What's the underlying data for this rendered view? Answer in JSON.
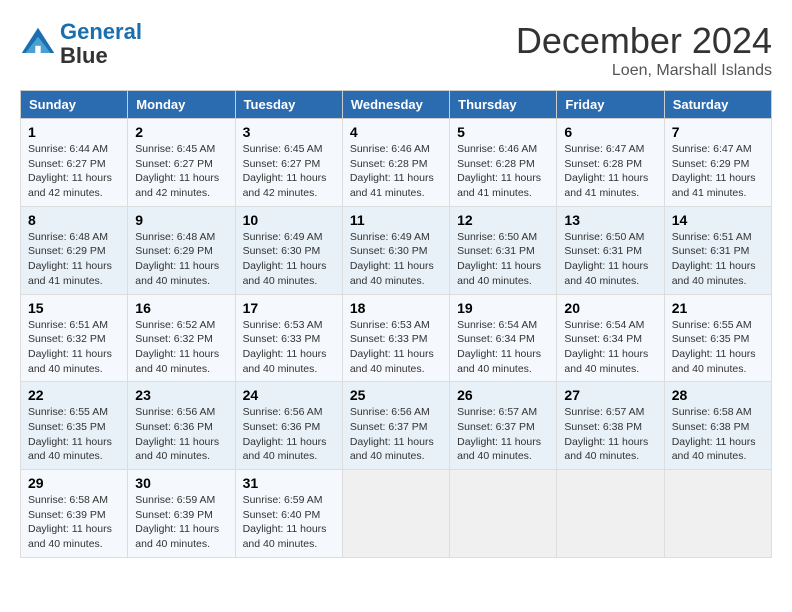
{
  "header": {
    "logo_line1": "General",
    "logo_line2": "Blue",
    "month": "December 2024",
    "location": "Loen, Marshall Islands"
  },
  "weekdays": [
    "Sunday",
    "Monday",
    "Tuesday",
    "Wednesday",
    "Thursday",
    "Friday",
    "Saturday"
  ],
  "weeks": [
    [
      {
        "day": "1",
        "sunrise": "6:44 AM",
        "sunset": "6:27 PM",
        "daylight": "11 hours and 42 minutes."
      },
      {
        "day": "2",
        "sunrise": "6:45 AM",
        "sunset": "6:27 PM",
        "daylight": "11 hours and 42 minutes."
      },
      {
        "day": "3",
        "sunrise": "6:45 AM",
        "sunset": "6:27 PM",
        "daylight": "11 hours and 42 minutes."
      },
      {
        "day": "4",
        "sunrise": "6:46 AM",
        "sunset": "6:28 PM",
        "daylight": "11 hours and 41 minutes."
      },
      {
        "day": "5",
        "sunrise": "6:46 AM",
        "sunset": "6:28 PM",
        "daylight": "11 hours and 41 minutes."
      },
      {
        "day": "6",
        "sunrise": "6:47 AM",
        "sunset": "6:28 PM",
        "daylight": "11 hours and 41 minutes."
      },
      {
        "day": "7",
        "sunrise": "6:47 AM",
        "sunset": "6:29 PM",
        "daylight": "11 hours and 41 minutes."
      }
    ],
    [
      {
        "day": "8",
        "sunrise": "6:48 AM",
        "sunset": "6:29 PM",
        "daylight": "11 hours and 41 minutes."
      },
      {
        "day": "9",
        "sunrise": "6:48 AM",
        "sunset": "6:29 PM",
        "daylight": "11 hours and 40 minutes."
      },
      {
        "day": "10",
        "sunrise": "6:49 AM",
        "sunset": "6:30 PM",
        "daylight": "11 hours and 40 minutes."
      },
      {
        "day": "11",
        "sunrise": "6:49 AM",
        "sunset": "6:30 PM",
        "daylight": "11 hours and 40 minutes."
      },
      {
        "day": "12",
        "sunrise": "6:50 AM",
        "sunset": "6:31 PM",
        "daylight": "11 hours and 40 minutes."
      },
      {
        "day": "13",
        "sunrise": "6:50 AM",
        "sunset": "6:31 PM",
        "daylight": "11 hours and 40 minutes."
      },
      {
        "day": "14",
        "sunrise": "6:51 AM",
        "sunset": "6:31 PM",
        "daylight": "11 hours and 40 minutes."
      }
    ],
    [
      {
        "day": "15",
        "sunrise": "6:51 AM",
        "sunset": "6:32 PM",
        "daylight": "11 hours and 40 minutes."
      },
      {
        "day": "16",
        "sunrise": "6:52 AM",
        "sunset": "6:32 PM",
        "daylight": "11 hours and 40 minutes."
      },
      {
        "day": "17",
        "sunrise": "6:53 AM",
        "sunset": "6:33 PM",
        "daylight": "11 hours and 40 minutes."
      },
      {
        "day": "18",
        "sunrise": "6:53 AM",
        "sunset": "6:33 PM",
        "daylight": "11 hours and 40 minutes."
      },
      {
        "day": "19",
        "sunrise": "6:54 AM",
        "sunset": "6:34 PM",
        "daylight": "11 hours and 40 minutes."
      },
      {
        "day": "20",
        "sunrise": "6:54 AM",
        "sunset": "6:34 PM",
        "daylight": "11 hours and 40 minutes."
      },
      {
        "day": "21",
        "sunrise": "6:55 AM",
        "sunset": "6:35 PM",
        "daylight": "11 hours and 40 minutes."
      }
    ],
    [
      {
        "day": "22",
        "sunrise": "6:55 AM",
        "sunset": "6:35 PM",
        "daylight": "11 hours and 40 minutes."
      },
      {
        "day": "23",
        "sunrise": "6:56 AM",
        "sunset": "6:36 PM",
        "daylight": "11 hours and 40 minutes."
      },
      {
        "day": "24",
        "sunrise": "6:56 AM",
        "sunset": "6:36 PM",
        "daylight": "11 hours and 40 minutes."
      },
      {
        "day": "25",
        "sunrise": "6:56 AM",
        "sunset": "6:37 PM",
        "daylight": "11 hours and 40 minutes."
      },
      {
        "day": "26",
        "sunrise": "6:57 AM",
        "sunset": "6:37 PM",
        "daylight": "11 hours and 40 minutes."
      },
      {
        "day": "27",
        "sunrise": "6:57 AM",
        "sunset": "6:38 PM",
        "daylight": "11 hours and 40 minutes."
      },
      {
        "day": "28",
        "sunrise": "6:58 AM",
        "sunset": "6:38 PM",
        "daylight": "11 hours and 40 minutes."
      }
    ],
    [
      {
        "day": "29",
        "sunrise": "6:58 AM",
        "sunset": "6:39 PM",
        "daylight": "11 hours and 40 minutes."
      },
      {
        "day": "30",
        "sunrise": "6:59 AM",
        "sunset": "6:39 PM",
        "daylight": "11 hours and 40 minutes."
      },
      {
        "day": "31",
        "sunrise": "6:59 AM",
        "sunset": "6:40 PM",
        "daylight": "11 hours and 40 minutes."
      },
      null,
      null,
      null,
      null
    ]
  ]
}
